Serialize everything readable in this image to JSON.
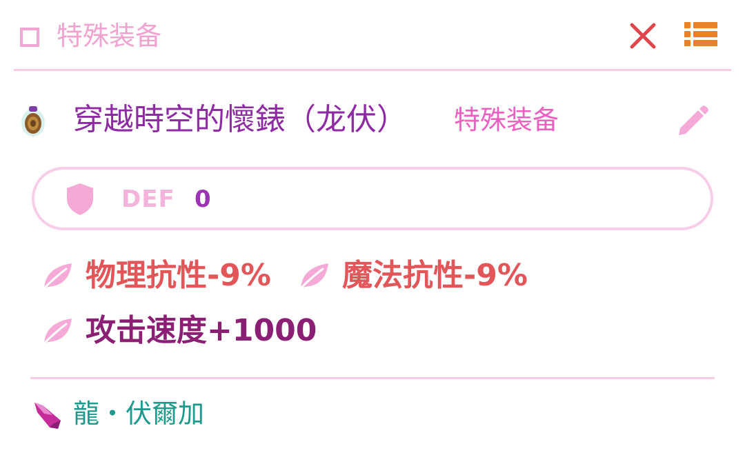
{
  "header": {
    "title": "特殊装备",
    "close_icon": "close-icon",
    "menu_icon": "list-icon"
  },
  "item": {
    "name": "穿越時空的懷錶（龙伏）",
    "type": "特殊装备",
    "icon": "pocket-watch-icon",
    "edit_icon": "pencil-icon"
  },
  "defense": {
    "label": "DEF",
    "value": "0",
    "icon": "shield-icon"
  },
  "stats": [
    {
      "text": "物理抗性-9%",
      "icon": "leaf-icon",
      "color": "#e2565a"
    },
    {
      "text": "魔法抗性-9%",
      "icon": "leaf-icon",
      "color": "#e2565a"
    },
    {
      "text": "攻击速度+1000",
      "icon": "leaf-icon",
      "color": "#8a1f73"
    }
  ],
  "author": {
    "name": "龍・伏爾加",
    "icon": "crystal-icon"
  },
  "colors": {
    "accent_pink": "#f0a3cf",
    "close_red": "#e0474c",
    "menu_orange": "#e8832a",
    "name_purple": "#8e2aa4",
    "author_teal": "#1d9a8c"
  }
}
